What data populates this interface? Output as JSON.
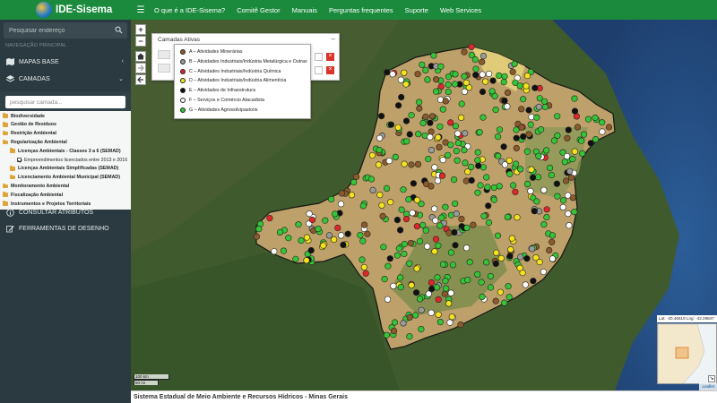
{
  "app": {
    "title": "IDE-Sisema"
  },
  "nav": {
    "links": [
      "O que é a IDE-Sisema?",
      "Comitê Gestor",
      "Manuais",
      "Perguntas frequentes",
      "Suporte",
      "Web Services"
    ]
  },
  "sidebar": {
    "search_placeholder": "Pesquisar endereço",
    "nav_heading": "NAVEGAÇÃO PRINCIPAL",
    "items": [
      {
        "label": "MAPAS BASE",
        "icon": "map-icon"
      },
      {
        "label": "CAMADAS",
        "icon": "layers-icon"
      },
      {
        "label": "CONSULTAR ATRIBUTOS",
        "icon": "info-icon"
      },
      {
        "label": "FERRAMENTAS DE DESENHO",
        "icon": "edit-icon"
      }
    ],
    "layer_search_placeholder": "pesquisar camada...",
    "tree": [
      {
        "label": "Biodiversidade",
        "type": "folder",
        "indent": 0
      },
      {
        "label": "Gestão de Resíduos",
        "type": "folder",
        "indent": 0
      },
      {
        "label": "Restrição Ambiental",
        "type": "folder",
        "indent": 0
      },
      {
        "label": "Regularização Ambiental",
        "type": "folder",
        "indent": 0
      },
      {
        "label": "Licenças Ambientais - Classes 3 a 6 (SEMAD)",
        "type": "folder",
        "indent": 1
      },
      {
        "label": "Empreendimentos licenciados entre 2013 e 2016",
        "type": "checkbox",
        "checked": true,
        "indent": 2
      },
      {
        "label": "Licenças Ambientais Simplificadas (SEMAD)",
        "type": "folder",
        "indent": 1
      },
      {
        "label": "Licenciamento Ambiental Municipal (SEMAD)",
        "type": "folder",
        "indent": 1
      },
      {
        "label": "Monitoramento Ambiental",
        "type": "folder",
        "indent": 0
      },
      {
        "label": "Fiscalização Ambiental",
        "type": "folder",
        "indent": 0
      },
      {
        "label": "Instrumentos e Projetos Territoriais",
        "type": "folder",
        "indent": 0
      }
    ]
  },
  "active_layers": {
    "title": "Camadas Ativas"
  },
  "legend": [
    {
      "label": "A – Atividades Minerárias",
      "color": "#8b5a2b"
    },
    {
      "label": "B – Atividades Industriais/Indústria Metalúrgica e Outras",
      "color": "#9a9a9a"
    },
    {
      "label": "C – Atividades Industriais/Indústria Química",
      "color": "#e0262b"
    },
    {
      "label": "D – Atividades Industriais/Indústria Alimentícia",
      "color": "#f4e31c"
    },
    {
      "label": "E – Atividades de Infraestrutura",
      "color": "#111111"
    },
    {
      "label": "F – Serviços e Comércio Atacadista",
      "color": "#ffffff"
    },
    {
      "label": "G – Atividades Agrossilvipastoris",
      "color": "#35c437"
    }
  ],
  "map": {
    "coord_readout": "Lat: -20.46619 Lng: -42.29847",
    "scale_km": "100 km",
    "scale_mi": "50 mi",
    "attribution": "Leaflet",
    "zoom_in": "+",
    "zoom_out": "−"
  },
  "footer": {
    "text": "Sistema Estadual de Meio Ambiente e Recursos Hídricos - Minas Gerais"
  }
}
